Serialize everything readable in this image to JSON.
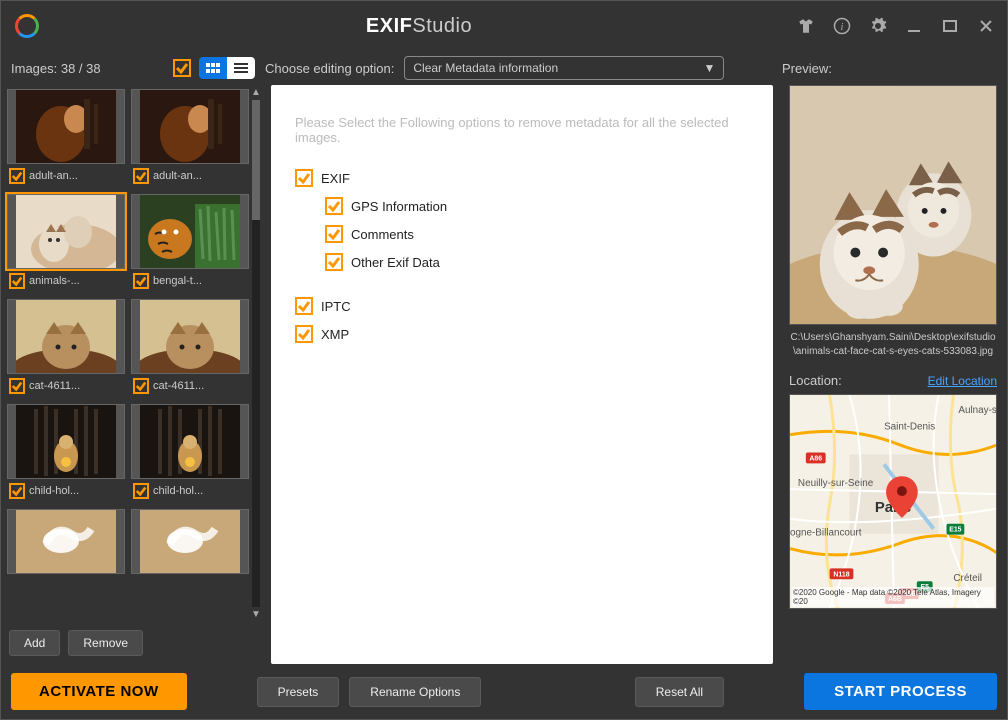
{
  "titlebar": {
    "app_bold": "EXIF",
    "app_light": "Studio"
  },
  "header": {
    "images_label": "Images: 38 / 38",
    "choose_label": "Choose editing option:",
    "dropdown_value": "Clear Metadata information",
    "preview_label": "Preview:"
  },
  "thumbs": [
    {
      "name": "adult-an..."
    },
    {
      "name": "adult-an..."
    },
    {
      "name": "animals-..."
    },
    {
      "name": "bengal-t..."
    },
    {
      "name": "cat-4611..."
    },
    {
      "name": "cat-4611..."
    },
    {
      "name": "child-hol..."
    },
    {
      "name": "child-hol..."
    },
    {
      "name": ""
    },
    {
      "name": ""
    }
  ],
  "left_buttons": {
    "add": "Add",
    "remove": "Remove"
  },
  "editor": {
    "hint": "Please Select the Following options to remove metadata for all the selected images.",
    "items": {
      "exif": "EXIF",
      "gps": "GPS Information",
      "comments": "Comments",
      "other": "Other Exif Data",
      "iptc": "IPTC",
      "xmp": "XMP"
    }
  },
  "preview": {
    "path": "C:\\Users\\Ghanshyam.Saini\\Desktop\\exifstudio\\animals-cat-face-cat-s-eyes-cats-533083.jpg",
    "location_label": "Location:",
    "edit_location": "Edit Location",
    "map": {
      "center": "Paris",
      "places": [
        "Saint-Denis",
        "Aulnay-so",
        "Neuilly-sur-Seine",
        "ogne-Billancourt",
        "Créteil"
      ],
      "shields": [
        "A86",
        "A86",
        "E15",
        "N118",
        "A6B",
        "E5"
      ],
      "attribution": "©2020 Google - Map data ©2020 Tele Atlas, Imagery ©20"
    }
  },
  "footer": {
    "activate": "ACTIVATE NOW",
    "presets": "Presets",
    "rename": "Rename Options",
    "reset": "Reset All",
    "start": "START PROCESS"
  }
}
